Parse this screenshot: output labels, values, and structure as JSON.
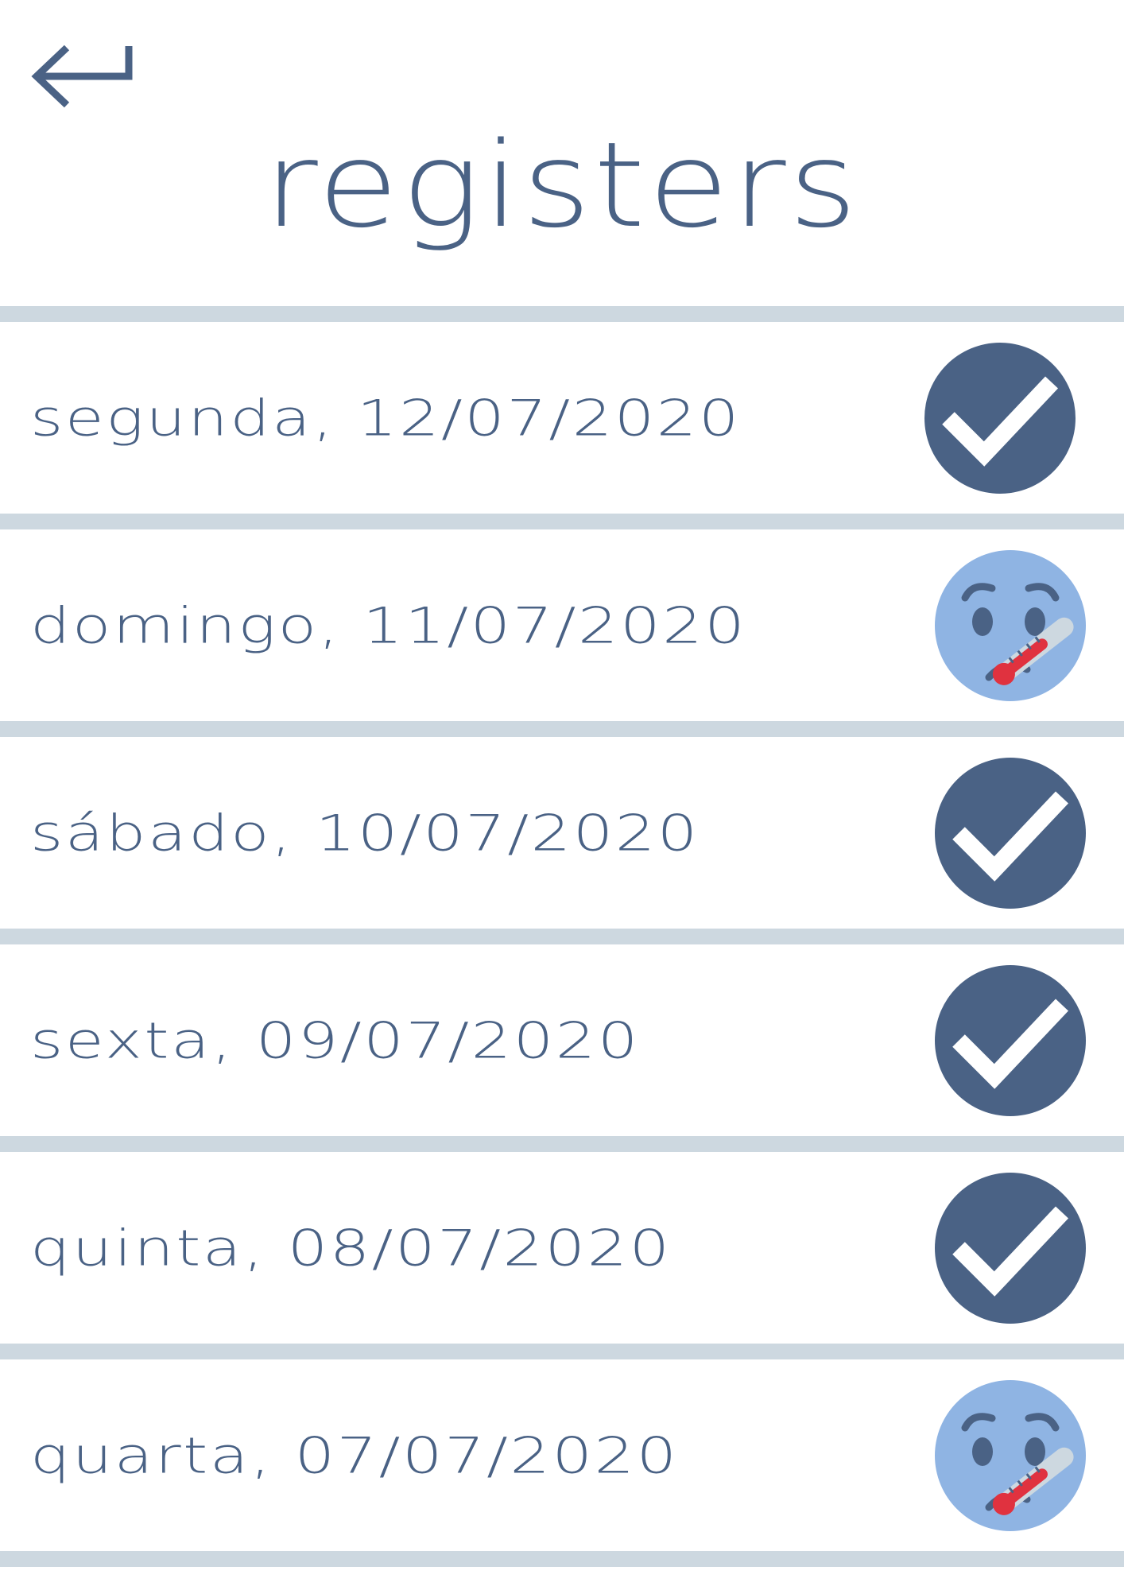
{
  "header": {
    "back_icon": "return-arrow-icon",
    "title": "registers"
  },
  "colors": {
    "primary": "#4a6285",
    "divider": "#cdd8e0",
    "sick_face": "#8fb4e3",
    "thermometer_red": "#e0323f"
  },
  "registers": [
    {
      "label": "segunda, 12/07/2020",
      "status": "check",
      "icon": "checkmark-circle-icon"
    },
    {
      "label": "domingo, 11/07/2020",
      "status": "sick",
      "icon": "sick-face-thermometer-icon"
    },
    {
      "label": "sábado, 10/07/2020",
      "status": "check",
      "icon": "checkmark-circle-icon"
    },
    {
      "label": "sexta, 09/07/2020",
      "status": "check",
      "icon": "checkmark-circle-icon"
    },
    {
      "label": "quinta, 08/07/2020",
      "status": "check",
      "icon": "checkmark-circle-icon"
    },
    {
      "label": "quarta, 07/07/2020",
      "status": "sick",
      "icon": "sick-face-thermometer-icon"
    }
  ]
}
